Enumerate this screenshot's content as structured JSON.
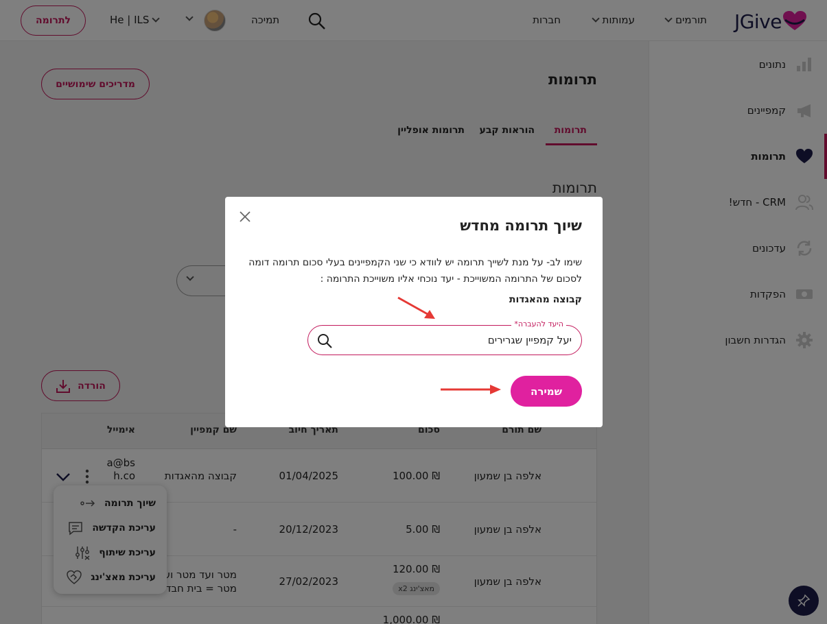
{
  "header": {
    "logo_text": "JGive",
    "nav": {
      "donors": "תורמים",
      "nonprofits": "עמותות",
      "companies": "חברות",
      "support": "תמיכה",
      "currency": "He | ILS"
    },
    "donate_label": "לתרומה"
  },
  "sidebar": {
    "items": [
      {
        "label": "נתונים",
        "icon": "bar-chart-icon"
      },
      {
        "label": "קמפיינים",
        "icon": "megaphone-icon"
      },
      {
        "label": "תרומות",
        "icon": "heart-icon"
      },
      {
        "label": "CRM - חדש!",
        "icon": "people-icon"
      },
      {
        "label": "עדכונים",
        "icon": "refresh-icon"
      },
      {
        "label": "הפקדות",
        "icon": "banknote-icon"
      },
      {
        "label": "הגדרות חשבון",
        "icon": "gear-icon"
      }
    ],
    "active_index": 2
  },
  "main": {
    "page_title": "תרומות",
    "guides_label": "מדריכים שימושיים",
    "tabs": [
      "תרומות",
      "הוראות קבע",
      "תרומות אופליין"
    ],
    "section_title": "תרומות",
    "download_label": "הורדה"
  },
  "table": {
    "headers": [
      "שם תורם",
      "סכום",
      "תאריך חיוב",
      "שם קמפיין",
      "אימייל"
    ],
    "rows": [
      {
        "donor": "אלפה בן שמעון",
        "amount": "₪ 100.00",
        "date": "01/04/2025",
        "campaign": "קבוצה מהאגדות",
        "email_1": "a@bs",
        "email_2": "h.co"
      },
      {
        "donor": "אלפה בן שמעון",
        "amount": "₪ 5.00",
        "date": "20/12/2023",
        "campaign": "-",
        "email_1": "",
        "email_2": ""
      },
      {
        "donor": "אלפה בן שמעון",
        "amount": "₪ 120.00",
        "badge": "מאצ'ינג x2",
        "date": "27/02/2023",
        "campaign_1": "מטר ועד מטר וע",
        "campaign_2": "מטר = בית חבד"
      },
      {
        "amount": "₪ 1,000.00"
      }
    ]
  },
  "context_menu": {
    "items": [
      {
        "label": "שיוך תרומה",
        "icon": "link-arrow-icon"
      },
      {
        "label": "עריכת הקדשה",
        "icon": "comment-icon"
      },
      {
        "label": "עריכת שיתוף",
        "icon": "sliders-icon"
      },
      {
        "label": "עריכת מאצ'ינג",
        "icon": "handshake-heart-icon"
      }
    ]
  },
  "modal": {
    "title": "שיוך תרומה מחדש",
    "description": "שימו לב- על מנת לשייך תרומה יש לוודא כי שני הקמפיינים בעלי סכום תרומה דומה לסכום של התרומה המשוייכת - יעד נוכחי אליו משוייכת התרומה :",
    "current_target": "קבוצה מהאגדות",
    "field_label": "היעד להעברה*",
    "field_value": "יעל קמפיין שגרירים",
    "save_label": "שמירה"
  },
  "colors": {
    "brand": "#c2185b",
    "save_button": "#e0219f",
    "logo_navy": "#1d1d4a",
    "annotation_arrow": "#e53935"
  }
}
